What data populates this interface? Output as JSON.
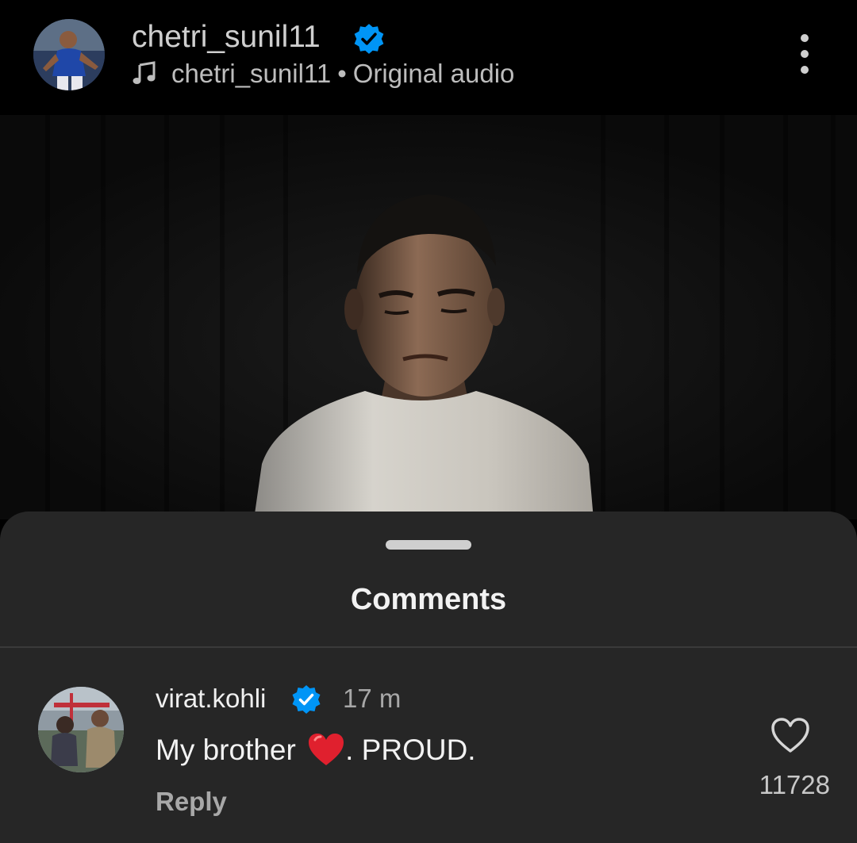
{
  "reel": {
    "author": {
      "username": "chetri_sunil11",
      "verified": true,
      "avatar": "soccer-player-avatar"
    },
    "audio": {
      "icon": "music-note-icon",
      "artist": "chetri_sunil11",
      "separator": "•",
      "label": "Original audio"
    },
    "more_icon": "more-vertical-icon"
  },
  "comments_sheet": {
    "title": "Comments",
    "comments": [
      {
        "username": "virat.kohli",
        "verified": true,
        "time": "17 m",
        "text_before": "My brother",
        "emoji": "❤️",
        "text_after": ". PROUD.",
        "reply_label": "Reply",
        "like_count": "11728",
        "like_icon": "heart-outline-icon"
      }
    ]
  },
  "colors": {
    "background": "#000000",
    "sheet": "#262626",
    "verified_badge": "#0095f6",
    "emoji_heart": "#e0202e",
    "secondary_text": "#a8a8a8"
  }
}
